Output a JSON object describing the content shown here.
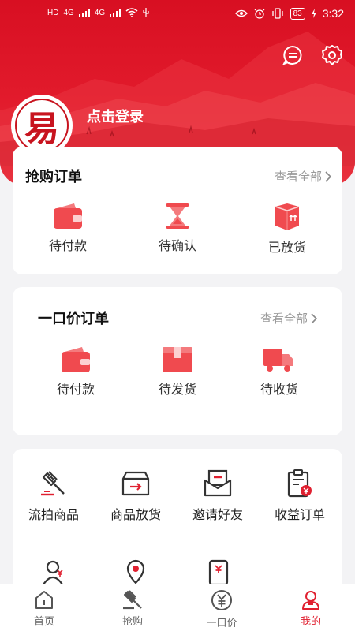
{
  "status_bar": {
    "network_labels": [
      "HD",
      "4G",
      "4G"
    ],
    "battery": "83",
    "time": "3:32"
  },
  "header": {
    "avatar_char": "易",
    "login_text": "点击登录",
    "icons": [
      "message-icon",
      "settings-icon"
    ]
  },
  "snapup_orders": {
    "title": "抢购订单",
    "view_all": "查看全部",
    "items": [
      {
        "label": "待付款",
        "icon": "wallet-icon"
      },
      {
        "label": "待确认",
        "icon": "hourglass-icon"
      },
      {
        "label": "已放货",
        "icon": "box-icon"
      }
    ]
  },
  "fixed_price_orders": {
    "title": "一口价订单",
    "view_all": "查看全部",
    "items": [
      {
        "label": "待付款",
        "icon": "wallet-icon"
      },
      {
        "label": "待发货",
        "icon": "package-icon"
      },
      {
        "label": "待收货",
        "icon": "truck-icon"
      }
    ]
  },
  "tools": {
    "items": [
      {
        "label": "流拍商品",
        "icon": "gavel-icon"
      },
      {
        "label": "商品放货",
        "icon": "inbox-icon"
      },
      {
        "label": "邀请好友",
        "icon": "envelope-icon"
      },
      {
        "label": "收益订单",
        "icon": "clipboard-money-icon"
      }
    ],
    "partial_icons": [
      "person-yuan-icon",
      "location-icon",
      "phone-yuan-icon"
    ]
  },
  "tabbar": {
    "tabs": [
      {
        "label": "首页",
        "icon": "home-icon",
        "active": false
      },
      {
        "label": "抢购",
        "icon": "gavel-icon",
        "active": false
      },
      {
        "label": "一口价",
        "icon": "yuan-circle-icon",
        "active": false
      },
      {
        "label": "我的",
        "icon": "user-icon",
        "active": true
      }
    ]
  },
  "colors": {
    "brand_red": "#e02030",
    "icon_red": "#f04a4f",
    "background": "#f3f3f5"
  }
}
